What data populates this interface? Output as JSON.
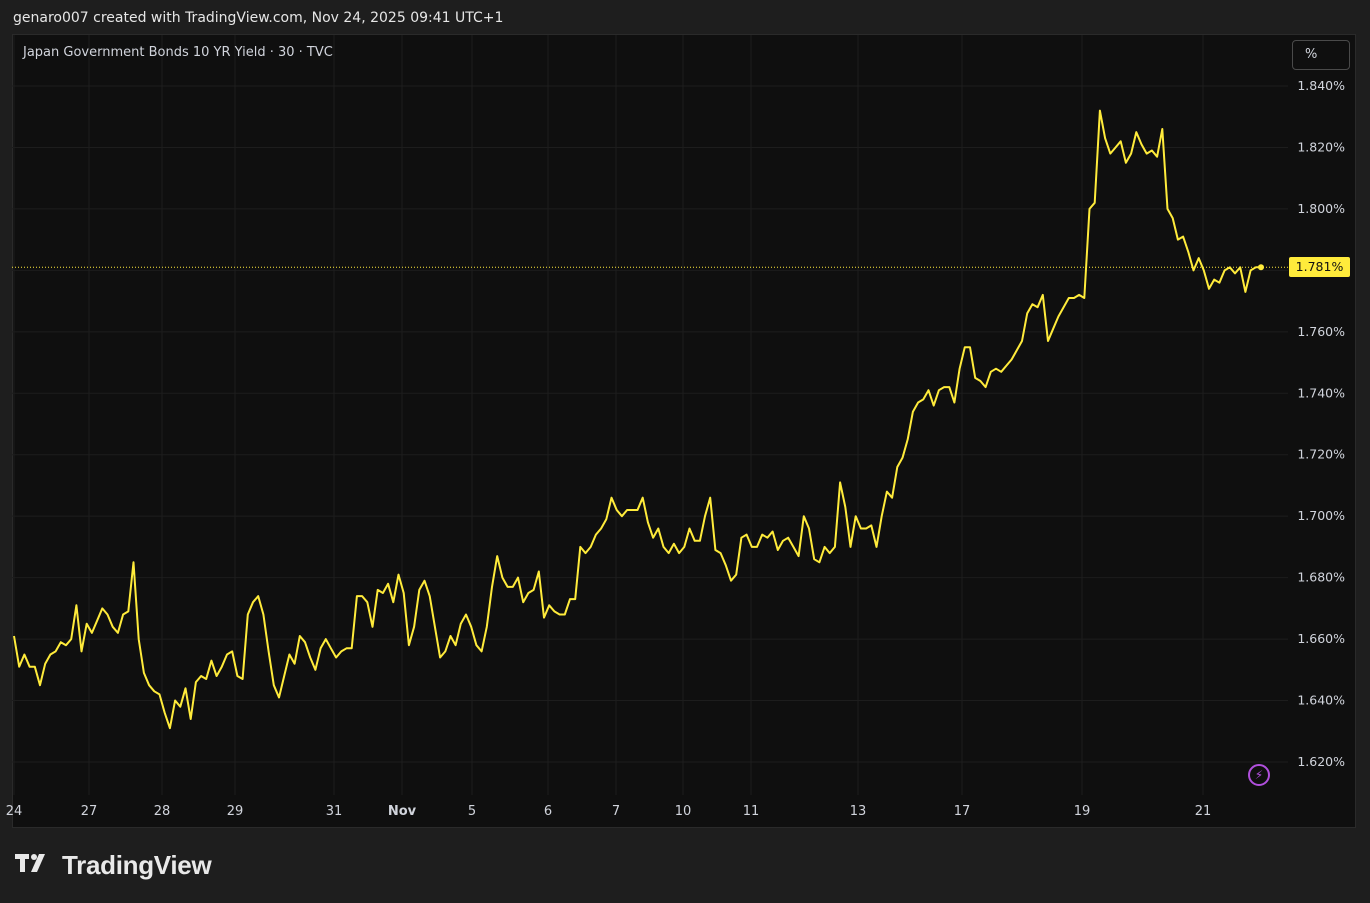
{
  "header": {
    "caption": "genaro007 created with TradingView.com, Nov 24, 2025 09:41 UTC+1"
  },
  "chart": {
    "symbol_title": "Japan Government Bonds 10 YR Yield · 30 · TVC",
    "unit_button": "%",
    "last_price_label": "1.781%",
    "alert_icon": "lightning-icon"
  },
  "brand": {
    "logo_text": "TradingView",
    "logo_icon": "tradingview-logo-icon"
  },
  "colors": {
    "line": "#ffeb3b",
    "background": "#0f0f0f",
    "grid": "#1d1d1d",
    "alert": "#b04fdc"
  },
  "chart_data": {
    "type": "line",
    "title": "Japan Government Bonds 10 YR Yield · 30 · TVC",
    "xlabel": "",
    "ylabel": "",
    "ylim": [
      1.61,
      1.855
    ],
    "y_ticks": [
      "1.840%",
      "1.820%",
      "1.800%",
      "1.780%",
      "1.760%",
      "1.740%",
      "1.720%",
      "1.700%",
      "1.680%",
      "1.660%",
      "1.640%",
      "1.620%"
    ],
    "y_tick_values": [
      1.84,
      1.82,
      1.8,
      1.78,
      1.76,
      1.74,
      1.72,
      1.7,
      1.68,
      1.66,
      1.64,
      1.62
    ],
    "x_tick_labels": [
      "24",
      "27",
      "28",
      "29",
      "31",
      "Nov",
      "5",
      "6",
      "7",
      "10",
      "11",
      "13",
      "17",
      "19",
      "21"
    ],
    "grid": true,
    "last_value": 1.781,
    "series": [
      {
        "values": [
          1.661,
          1.651,
          1.655,
          1.651,
          1.651,
          1.645,
          1.652,
          1.655,
          1.656,
          1.659,
          1.658,
          1.66,
          1.671,
          1.656,
          1.665,
          1.662,
          1.666,
          1.67,
          1.668,
          1.664,
          1.662,
          1.668,
          1.669,
          1.685,
          1.66,
          1.649,
          1.645,
          1.643,
          1.642,
          1.636,
          1.631,
          1.64,
          1.638,
          1.644,
          1.634,
          1.646,
          1.648,
          1.647,
          1.653,
          1.648,
          1.651,
          1.655,
          1.656,
          1.648,
          1.647,
          1.668,
          1.672,
          1.674,
          1.668,
          1.656,
          1.645,
          1.641,
          1.648,
          1.655,
          1.652,
          1.661,
          1.659,
          1.654,
          1.65,
          1.657,
          1.66,
          1.657,
          1.654,
          1.656,
          1.657,
          1.657,
          1.674,
          1.674,
          1.672,
          1.664,
          1.676,
          1.675,
          1.678,
          1.672,
          1.681,
          1.675,
          1.658,
          1.664,
          1.676,
          1.679,
          1.674,
          1.664,
          1.654,
          1.656,
          1.661,
          1.658,
          1.665,
          1.668,
          1.664,
          1.658,
          1.656,
          1.664,
          1.677,
          1.687,
          1.68,
          1.677,
          1.677,
          1.68,
          1.672,
          1.675,
          1.676,
          1.682,
          1.667,
          1.671,
          1.669,
          1.668,
          1.668,
          1.673,
          1.673,
          1.69,
          1.688,
          1.69,
          1.694,
          1.696,
          1.699,
          1.706,
          1.702,
          1.7,
          1.702,
          1.702,
          1.702,
          1.706,
          1.698,
          1.693,
          1.696,
          1.69,
          1.688,
          1.691,
          1.688,
          1.69,
          1.696,
          1.692,
          1.692,
          1.7,
          1.706,
          1.689,
          1.688,
          1.684,
          1.679,
          1.681,
          1.693,
          1.694,
          1.69,
          1.69,
          1.694,
          1.693,
          1.695,
          1.689,
          1.692,
          1.693,
          1.69,
          1.687,
          1.7,
          1.696,
          1.686,
          1.685,
          1.69,
          1.688,
          1.69,
          1.711,
          1.703,
          1.69,
          1.7,
          1.696,
          1.696,
          1.697,
          1.69,
          1.7,
          1.708,
          1.706,
          1.716,
          1.719,
          1.725,
          1.734,
          1.737,
          1.738,
          1.741,
          1.736,
          1.741,
          1.742,
          1.742,
          1.737,
          1.748,
          1.755,
          1.755,
          1.745,
          1.744,
          1.742,
          1.747,
          1.748,
          1.747,
          1.749,
          1.751,
          1.754,
          1.757,
          1.766,
          1.769,
          1.768,
          1.772,
          1.757,
          1.761,
          1.765,
          1.768,
          1.771,
          1.771,
          1.772,
          1.771,
          1.8,
          1.802,
          1.832,
          1.823,
          1.818,
          1.82,
          1.822,
          1.815,
          1.818,
          1.825,
          1.821,
          1.818,
          1.819,
          1.817,
          1.826,
          1.8,
          1.797,
          1.79,
          1.791,
          1.786,
          1.78,
          1.784,
          1.78,
          1.774,
          1.777,
          1.776,
          1.78,
          1.781,
          1.779,
          1.781,
          1.773,
          1.78,
          1.781,
          1.781
        ]
      }
    ]
  }
}
